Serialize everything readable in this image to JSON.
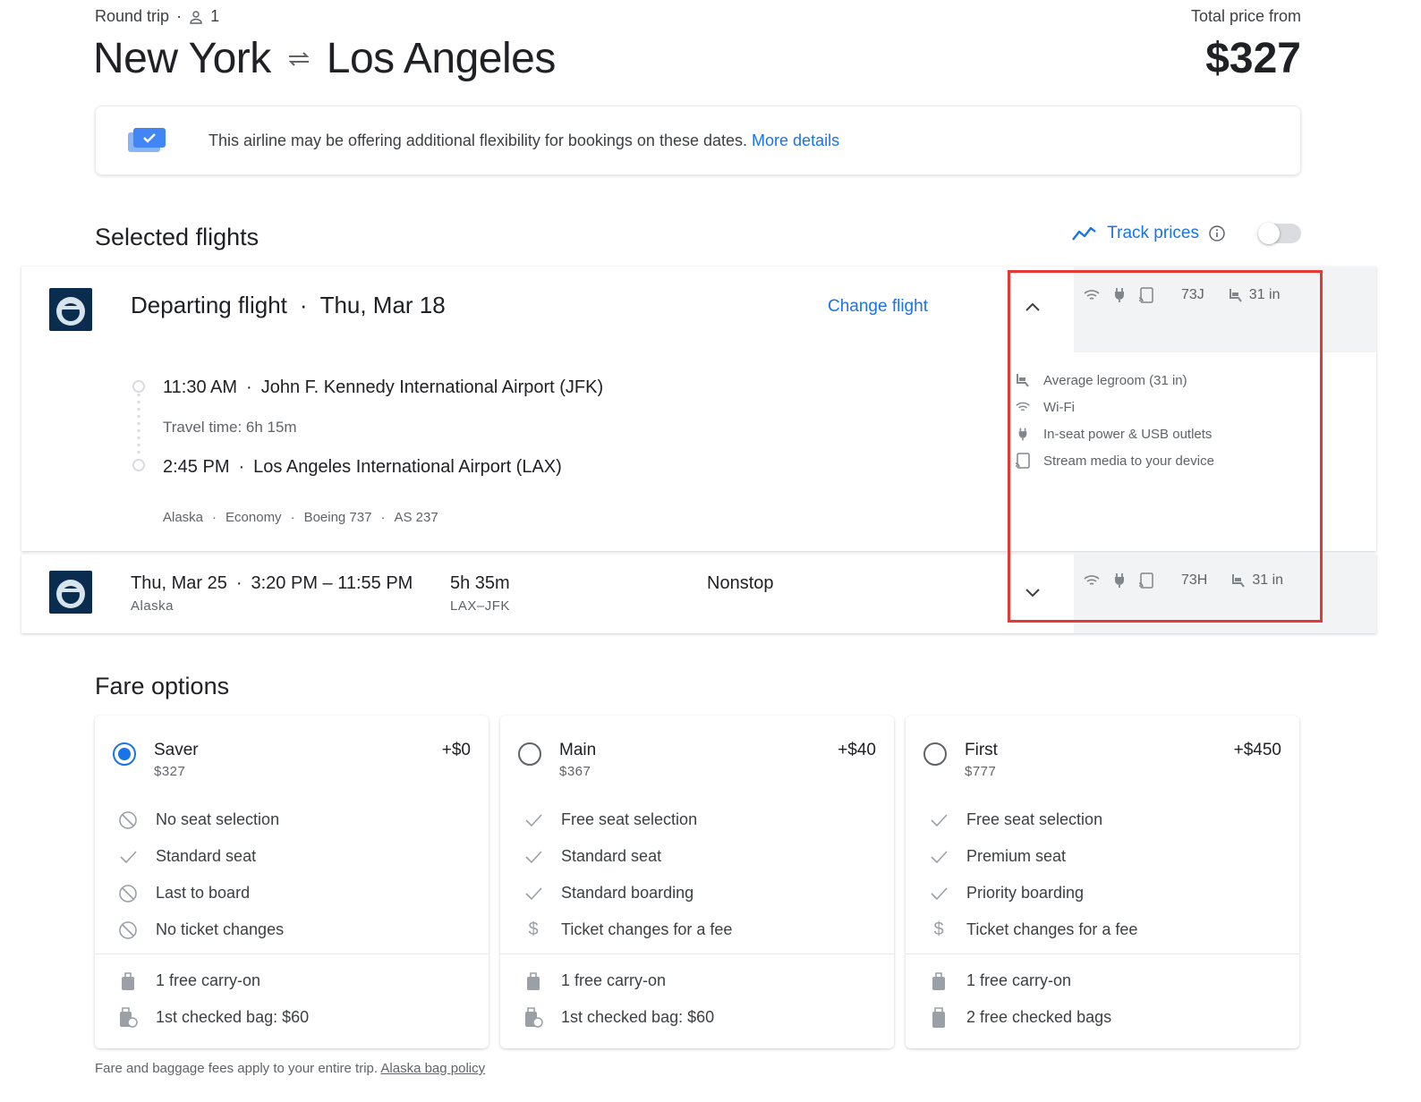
{
  "header": {
    "trip_type": "Round trip",
    "passenger_count": "1",
    "origin": "New York",
    "destination": "Los Angeles",
    "total_label": "Total price from",
    "total_price": "$327"
  },
  "banner": {
    "text": "This airline may be offering additional flexibility for bookings on these dates.",
    "link": "More details"
  },
  "selected": {
    "title": "Selected flights",
    "track_label": "Track prices",
    "track_enabled": false
  },
  "departing": {
    "title": "Departing flight",
    "date": "Thu, Mar 18",
    "change_label": "Change flight",
    "depart_time": "11:30 AM",
    "depart_airport": "John F. Kennedy International Airport (JFK)",
    "travel_time": "Travel time: 6h 15m",
    "arrive_time": "2:45 PM",
    "arrive_airport": "Los Angeles International Airport (LAX)",
    "airline": "Alaska",
    "cabin": "Economy",
    "aircraft": "Boeing 737",
    "flight_no": "AS 237",
    "seat": "73J",
    "legroom": "31 in",
    "amenities": [
      "Average legroom (31 in)",
      "Wi-Fi",
      "In-seat power & USB outlets",
      "Stream media to your device"
    ]
  },
  "returning": {
    "date": "Thu, Mar 25",
    "times": "3:20 PM – 11:55 PM",
    "airline": "Alaska",
    "duration": "5h 35m",
    "route": "LAX–JFK",
    "stops": "Nonstop",
    "seat": "73H",
    "legroom": "31 in"
  },
  "fares": {
    "title": "Fare options",
    "options": [
      {
        "name": "Saver",
        "price": "$327",
        "delta": "+$0",
        "selected": true,
        "features": [
          "No seat selection",
          "Standard seat",
          "Last to board",
          "No ticket changes"
        ],
        "bags": [
          "1 free carry-on",
          "1st checked bag: $60"
        ]
      },
      {
        "name": "Main",
        "price": "$367",
        "delta": "+$40",
        "selected": false,
        "features": [
          "Free seat selection",
          "Standard seat",
          "Standard boarding",
          "Ticket changes for a fee"
        ],
        "bags": [
          "1 free carry-on",
          "1st checked bag: $60"
        ]
      },
      {
        "name": "First",
        "price": "$777",
        "delta": "+$450",
        "selected": false,
        "features": [
          "Free seat selection",
          "Premium seat",
          "Priority boarding",
          "Ticket changes for a fee"
        ],
        "bags": [
          "1 free carry-on",
          "2 free checked bags"
        ]
      }
    ],
    "footnote": "Fare and baggage fees apply to your entire trip.",
    "footnote_link": "Alaska bag policy"
  },
  "colors": {
    "accent": "#1a73e8",
    "highlight": "#e53935",
    "text": "#202124",
    "muted": "#5f6368"
  }
}
